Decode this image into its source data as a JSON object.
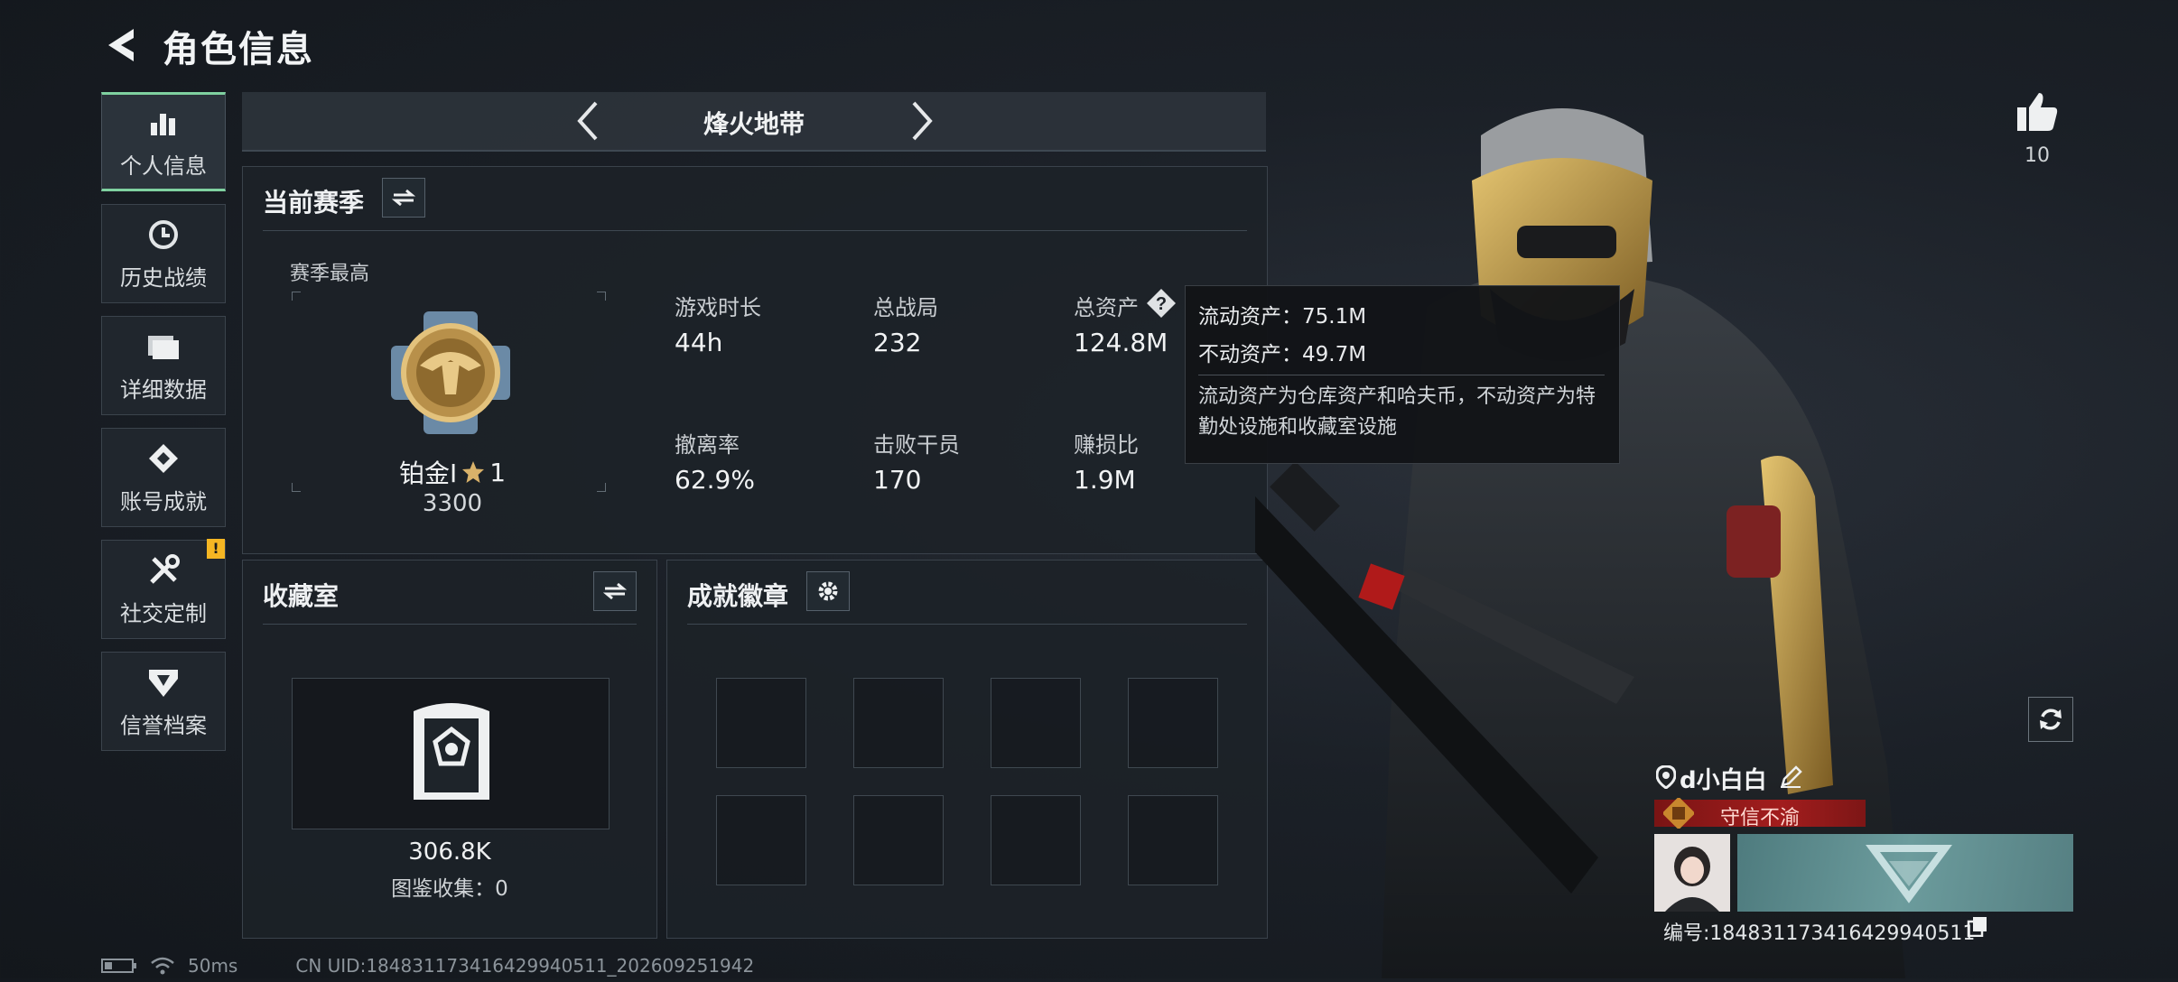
{
  "header": {
    "title": "角色信息"
  },
  "nav": {
    "items": [
      {
        "label": "个人信息",
        "icon": "bar-chart-icon",
        "active": true
      },
      {
        "label": "历史战绩",
        "icon": "history-clock-icon"
      },
      {
        "label": "详细数据",
        "icon": "folder-icon"
      },
      {
        "label": "账号成就",
        "icon": "achievement-icon"
      },
      {
        "label": "社交定制",
        "icon": "tools-icon",
        "badge": "!"
      },
      {
        "label": "信誉档案",
        "icon": "shield-emblem-icon"
      }
    ]
  },
  "mode": {
    "name": "烽火地带"
  },
  "season": {
    "title": "当前赛季",
    "best_label": "赛季最高",
    "rank_name": "铂金I",
    "rank_stars": "1",
    "rank_score": "3300",
    "stats": [
      {
        "label": "游戏时长",
        "value": "44h"
      },
      {
        "label": "总战局",
        "value": "232"
      },
      {
        "label": "总资产",
        "value": "124.8M"
      },
      {
        "label": "撤离率",
        "value": "62.9%"
      },
      {
        "label": "击败干员",
        "value": "170"
      },
      {
        "label": "赚损比",
        "value": "1.9M"
      }
    ]
  },
  "tooltip": {
    "liquid": "流动资产：75.1M",
    "fixed": "不动资产：49.7M",
    "note": "流动资产为仓库资产和哈夫币，不动资产为特勤处设施和收藏室设施"
  },
  "collection": {
    "title": "收藏室",
    "value": "306.8K",
    "catalog": "图鉴收集：0"
  },
  "badges": {
    "title": "成就徽章"
  },
  "player": {
    "likes": "10",
    "name": "d小白白",
    "reputation": "守信不渝",
    "id": "编号:1848311734164299405​11"
  },
  "status": {
    "ping": "50ms",
    "uid": "CN UID:184831173416429940511_202609251942"
  },
  "colors": {
    "accent": "#7fd1a0",
    "warning": "#f5b623",
    "reputation": "#a21d1d"
  }
}
